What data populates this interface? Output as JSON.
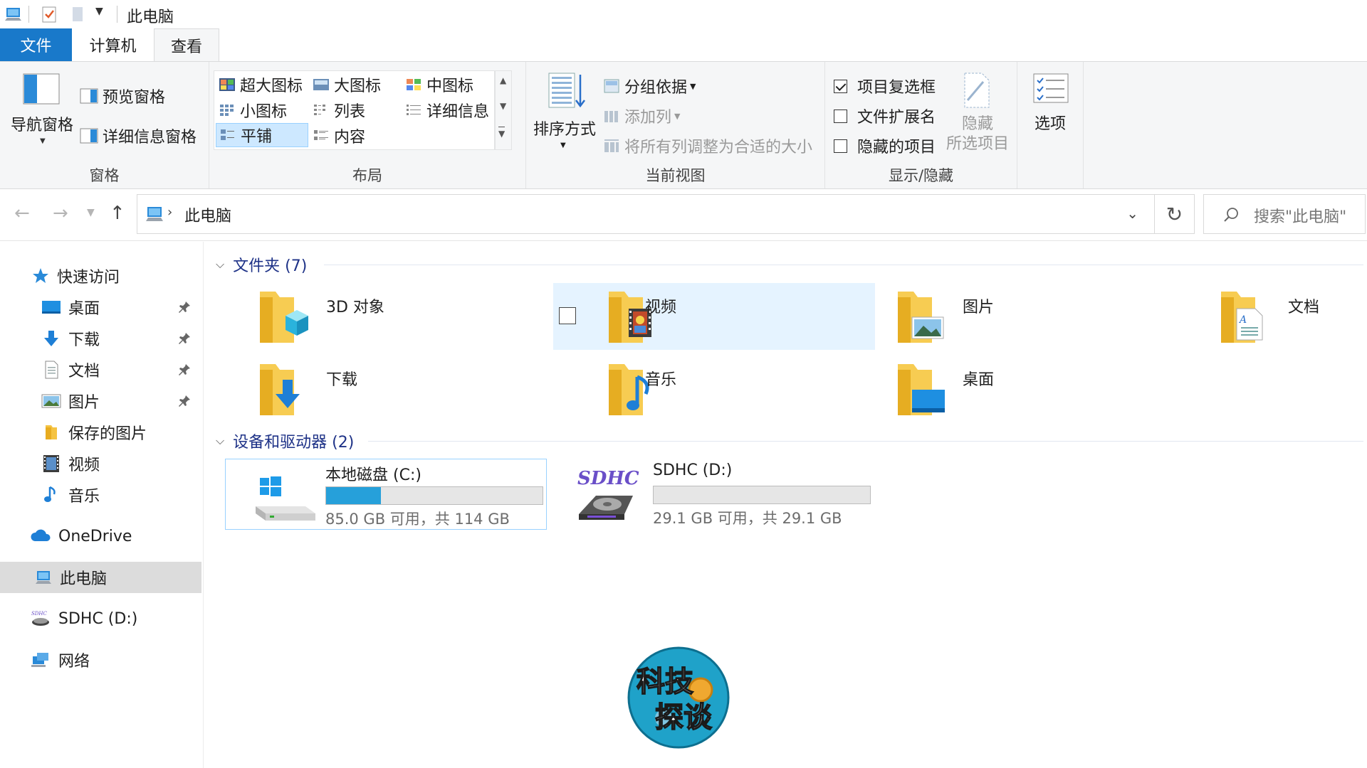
{
  "window": {
    "title": "此电脑"
  },
  "ribbon_tabs": [
    {
      "label": "文件"
    },
    {
      "label": "计算机"
    },
    {
      "label": "查看"
    }
  ],
  "ribbon": {
    "panes": {
      "label": "窗格",
      "nav_pane": "导航窗格",
      "preview_pane": "预览窗格",
      "details_pane": "详细信息窗格"
    },
    "layout": {
      "label": "布局",
      "items": [
        "超大图标",
        "大图标",
        "中图标",
        "小图标",
        "列表",
        "详细信息",
        "平铺",
        "内容"
      ],
      "selected": "平铺"
    },
    "current_view": {
      "label": "当前视图",
      "sort_by": "排序方式",
      "group_by": "分组依据",
      "add_column": "添加列",
      "size_all_columns": "将所有列调整为合适的大小"
    },
    "show_hide": {
      "label": "显示/隐藏",
      "item_checkboxes": {
        "label": "项目复选框",
        "checked": true
      },
      "file_extensions": {
        "label": "文件扩展名",
        "checked": false
      },
      "hidden_items": {
        "label": "隐藏的项目",
        "checked": false
      },
      "hide_selected": "隐藏",
      "hide_selected_2": "所选项目"
    },
    "options": {
      "label": "选项"
    }
  },
  "address_bar": {
    "path": "此电脑",
    "search_placeholder": "搜索\"此电脑\""
  },
  "sidebar": {
    "quick_access": "快速访问",
    "items": [
      {
        "label": "桌面",
        "pinned": true
      },
      {
        "label": "下载",
        "pinned": true
      },
      {
        "label": "文档",
        "pinned": true
      },
      {
        "label": "图片",
        "pinned": true
      },
      {
        "label": "保存的图片",
        "pinned": false
      },
      {
        "label": "视频",
        "pinned": false
      },
      {
        "label": "音乐",
        "pinned": false
      }
    ],
    "onedrive": "OneDrive",
    "this_pc": "此电脑",
    "sdhc": "SDHC (D:)",
    "network": "网络"
  },
  "content": {
    "folders_header": "文件夹 (7)",
    "folders": [
      {
        "name": "3D 对象"
      },
      {
        "name": "视频"
      },
      {
        "name": "图片"
      },
      {
        "name": "文档"
      },
      {
        "name": "下载"
      },
      {
        "name": "音乐"
      },
      {
        "name": "桌面"
      }
    ],
    "drives_header": "设备和驱动器 (2)",
    "drives": [
      {
        "name": "本地磁盘 (C:)",
        "free_text": "85.0 GB 可用，共 114 GB",
        "used_fraction": 0.254
      },
      {
        "name": "SDHC (D:)",
        "free_text": "29.1 GB 可用，共 29.1 GB",
        "used_fraction": 0.0,
        "logo_text": "SDHC"
      }
    ]
  },
  "watermark": {
    "line1": "科技",
    "line2": "探谈"
  },
  "colors": {
    "accent": "#1979ca",
    "selection": "#cde8ff",
    "hover": "#e5f3ff",
    "bar": "#26a0da"
  }
}
